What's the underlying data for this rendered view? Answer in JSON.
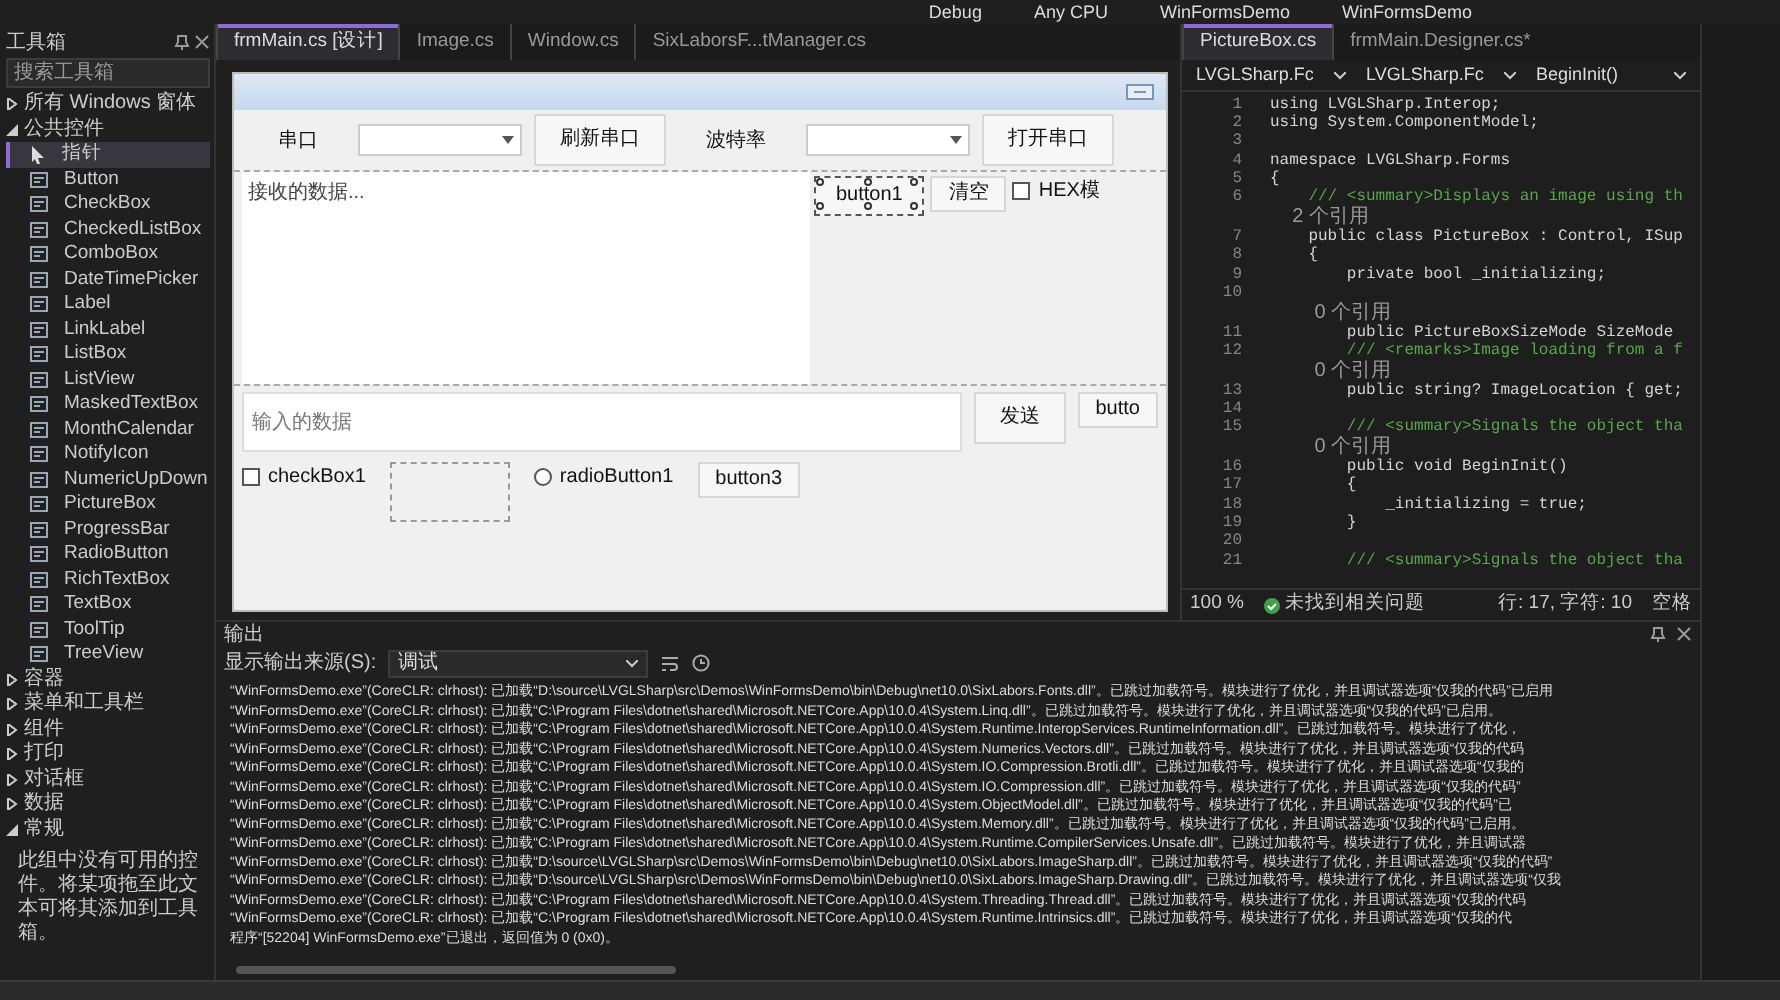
{
  "toolbar": {
    "items": [
      "Debug",
      "Any CPU",
      "WinFormsDemo",
      "WinFormsDemo"
    ]
  },
  "designer_tabs": [
    {
      "label": "frmMain.cs [设计]",
      "selected": true
    },
    {
      "label": "Image.cs",
      "selected": false
    },
    {
      "label": "Window.cs",
      "selected": false
    },
    {
      "label": "SixLaborsF...tManager.cs",
      "selected": false
    }
  ],
  "toolbox": {
    "title": "工具箱",
    "search": {
      "placeholder": "搜索工具箱"
    },
    "groups": [
      {
        "label": "所有 Windows 窗体",
        "expanded": false
      },
      {
        "label": "公共控件",
        "expanded": true,
        "items": [
          {
            "label": "指针",
            "selected": true
          },
          {
            "label": "Button",
            "selected": false
          },
          {
            "label": "CheckBox",
            "selected": false
          },
          {
            "label": "CheckedListBox",
            "selected": false
          },
          {
            "label": "ComboBox",
            "selected": false
          },
          {
            "label": "DateTimePicker",
            "selected": false
          },
          {
            "label": "Label",
            "selected": false
          },
          {
            "label": "LinkLabel",
            "selected": false
          },
          {
            "label": "ListBox",
            "selected": false
          },
          {
            "label": "ListView",
            "selected": false
          },
          {
            "label": "MaskedTextBox",
            "selected": false
          },
          {
            "label": "MonthCalendar",
            "selected": false
          },
          {
            "label": "NotifyIcon",
            "selected": false
          },
          {
            "label": "NumericUpDown",
            "selected": false
          },
          {
            "label": "PictureBox",
            "selected": false
          },
          {
            "label": "ProgressBar",
            "selected": false
          },
          {
            "label": "RadioButton",
            "selected": false
          },
          {
            "label": "RichTextBox",
            "selected": false
          },
          {
            "label": "TextBox",
            "selected": false
          },
          {
            "label": "ToolTip",
            "selected": false
          },
          {
            "label": "TreeView",
            "selected": false
          }
        ]
      },
      {
        "label": "容器",
        "expanded": false
      },
      {
        "label": "菜单和工具栏",
        "expanded": false
      },
      {
        "label": "组件",
        "expanded": false
      },
      {
        "label": "打印",
        "expanded": false
      },
      {
        "label": "对话框",
        "expanded": false
      },
      {
        "label": "数据",
        "expanded": false
      },
      {
        "label": "常规",
        "expanded": true,
        "message": "此组中没有可用的控件。将某项拖至此文本可将其添加到工具箱。"
      }
    ]
  },
  "form": {
    "top_row": [
      {
        "kind": "label",
        "text": "串口"
      },
      {
        "kind": "combo"
      },
      {
        "kind": "button",
        "text": "刷新串口"
      },
      {
        "kind": "label",
        "text": "波特率"
      },
      {
        "kind": "combo"
      },
      {
        "kind": "button",
        "text": "打开串口"
      }
    ],
    "receive_box": {
      "placeholder": "接收的数据..."
    },
    "side_controls": [
      {
        "kind": "button",
        "text": "button1",
        "selected": true
      },
      {
        "kind": "button",
        "text": "清空",
        "selected": false
      },
      {
        "kind": "checkbox",
        "text": "HEX模",
        "checked": false
      }
    ],
    "send_box": {
      "placeholder": "输入的数据"
    },
    "send_controls": [
      {
        "kind": "button",
        "text": "发送"
      },
      {
        "kind": "button",
        "text": "butto"
      }
    ],
    "bottom_row": [
      {
        "kind": "checkbox",
        "text": "checkBox1",
        "checked": false
      },
      {
        "kind": "panel"
      },
      {
        "kind": "radio",
        "text": "radioButton1",
        "checked": false
      },
      {
        "kind": "button",
        "text": "button3"
      }
    ]
  },
  "editor": {
    "tabs": [
      {
        "label": "PictureBox.cs",
        "selected": true
      },
      {
        "label": "frmMain.Designer.cs*",
        "selected": false
      }
    ],
    "nav": [
      "LVGLSharp.Fc",
      "LVGLSharp.Fc",
      "BeginInit()"
    ],
    "lines": [
      {
        "kind": "code",
        "number": "1",
        "text": "using LVGLSharp.Interop;"
      },
      {
        "kind": "code",
        "number": "2",
        "text": "using System.ComponentModel;"
      },
      {
        "kind": "code",
        "number": "3"
      },
      {
        "kind": "code",
        "number": "4",
        "text": "namespace LVGLSharp.Forms"
      },
      {
        "kind": "code",
        "number": "5",
        "text": "{"
      },
      {
        "kind": "comment",
        "number": "6",
        "text": "    /// <summary>Displays an image using th"
      },
      {
        "kind": "lens",
        "text": "    2 个引用"
      },
      {
        "kind": "code",
        "number": "7",
        "text": "    public class PictureBox : Control, ISup"
      },
      {
        "kind": "code",
        "number": "8",
        "text": "    {"
      },
      {
        "kind": "code",
        "number": "9",
        "text": "        private bool _initializing;"
      },
      {
        "kind": "code",
        "number": "10"
      },
      {
        "kind": "lens",
        "text": "        0 个引用"
      },
      {
        "kind": "code",
        "number": "11",
        "text": "        public PictureBoxSizeMode SizeMode"
      },
      {
        "kind": "comment",
        "number": "12",
        "text": "        /// <remarks>Image loading from a f"
      },
      {
        "kind": "lens",
        "text": "        0 个引用"
      },
      {
        "kind": "code",
        "number": "13",
        "text": "        public string? ImageLocation { get;"
      },
      {
        "kind": "code",
        "number": "14"
      },
      {
        "kind": "comment",
        "number": "15",
        "text": "        /// <summary>Signals the object tha"
      },
      {
        "kind": "lens",
        "text": "        0 个引用"
      },
      {
        "kind": "code",
        "number": "16",
        "text": "        public void BeginInit()"
      },
      {
        "kind": "code",
        "number": "17",
        "text": "        {"
      },
      {
        "kind": "code",
        "number": "18",
        "text": "            _initializing = true;"
      },
      {
        "kind": "code",
        "number": "19",
        "text": "        }"
      },
      {
        "kind": "code",
        "number": "20"
      },
      {
        "kind": "comment",
        "number": "21",
        "text": "        /// <summary>Signals the object tha"
      }
    ],
    "status": {
      "zoom": "100 %",
      "issues": "未找到相关问题",
      "position": "行: 17, 字符: 10",
      "indent": "空格"
    }
  },
  "output": {
    "title": "输出",
    "source_label": "显示输出来源(S):",
    "source_value": "调试",
    "lines": [
      "“WinFormsDemo.exe”(CoreCLR: clrhost): 已加载“D:\\source\\LVGLSharp\\src\\Demos\\WinFormsDemo\\bin\\Debug\\net10.0\\SixLabors.Fonts.dll”。已跳过加载符号。模块进行了优化，并且调试器选项“仅我的代码”已启用",
      "“WinFormsDemo.exe”(CoreCLR: clrhost): 已加载“C:\\Program Files\\dotnet\\shared\\Microsoft.NETCore.App\\10.0.4\\System.Linq.dll”。已跳过加载符号。模块进行了优化，并且调试器选项“仅我的代码”已启用。",
      "“WinFormsDemo.exe”(CoreCLR: clrhost): 已加载“C:\\Program Files\\dotnet\\shared\\Microsoft.NETCore.App\\10.0.4\\System.Runtime.InteropServices.RuntimeInformation.dll”。已跳过加载符号。模块进行了优化，",
      "“WinFormsDemo.exe”(CoreCLR: clrhost): 已加载“C:\\Program Files\\dotnet\\shared\\Microsoft.NETCore.App\\10.0.4\\System.Numerics.Vectors.dll”。已跳过加载符号。模块进行了优化，并且调试器选项“仅我的代码",
      "“WinFormsDemo.exe”(CoreCLR: clrhost): 已加载“C:\\Program Files\\dotnet\\shared\\Microsoft.NETCore.App\\10.0.4\\System.IO.Compression.Brotli.dll”。已跳过加载符号。模块进行了优化，并且调试器选项“仅我的",
      "“WinFormsDemo.exe”(CoreCLR: clrhost): 已加载“C:\\Program Files\\dotnet\\shared\\Microsoft.NETCore.App\\10.0.4\\System.IO.Compression.dll”。已跳过加载符号。模块进行了优化，并且调试器选项“仅我的代码”",
      "“WinFormsDemo.exe”(CoreCLR: clrhost): 已加载“C:\\Program Files\\dotnet\\shared\\Microsoft.NETCore.App\\10.0.4\\System.ObjectModel.dll”。已跳过加载符号。模块进行了优化，并且调试器选项“仅我的代码”已",
      "“WinFormsDemo.exe”(CoreCLR: clrhost): 已加载“C:\\Program Files\\dotnet\\shared\\Microsoft.NETCore.App\\10.0.4\\System.Memory.dll”。已跳过加载符号。模块进行了优化，并且调试器选项“仅我的代码”已启用。",
      "“WinFormsDemo.exe”(CoreCLR: clrhost): 已加载“C:\\Program Files\\dotnet\\shared\\Microsoft.NETCore.App\\10.0.4\\System.Runtime.CompilerServices.Unsafe.dll”。已跳过加载符号。模块进行了优化，并且调试器",
      "“WinFormsDemo.exe”(CoreCLR: clrhost): 已加载“D:\\source\\LVGLSharp\\src\\Demos\\WinFormsDemo\\bin\\Debug\\net10.0\\SixLabors.ImageSharp.dll”。已跳过加载符号。模块进行了优化，并且调试器选项“仅我的代码”",
      "“WinFormsDemo.exe”(CoreCLR: clrhost): 已加载“D:\\source\\LVGLSharp\\src\\Demos\\WinFormsDemo\\bin\\Debug\\net10.0\\SixLabors.ImageSharp.Drawing.dll”。已跳过加载符号。模块进行了优化，并且调试器选项“仅我",
      "“WinFormsDemo.exe”(CoreCLR: clrhost): 已加载“C:\\Program Files\\dotnet\\shared\\Microsoft.NETCore.App\\10.0.4\\System.Threading.Thread.dll”。已跳过加载符号。模块进行了优化，并且调试器选项“仅我的代码",
      "“WinFormsDemo.exe”(CoreCLR: clrhost): 已加载“C:\\Program Files\\dotnet\\shared\\Microsoft.NETCore.App\\10.0.4\\System.Runtime.Intrinsics.dll”。已跳过加载符号。模块进行了优化，并且调试器选项“仅我的代",
      "程序“[52204] WinFormsDemo.exe”已退出，返回值为 0 (0x0)。"
    ]
  }
}
